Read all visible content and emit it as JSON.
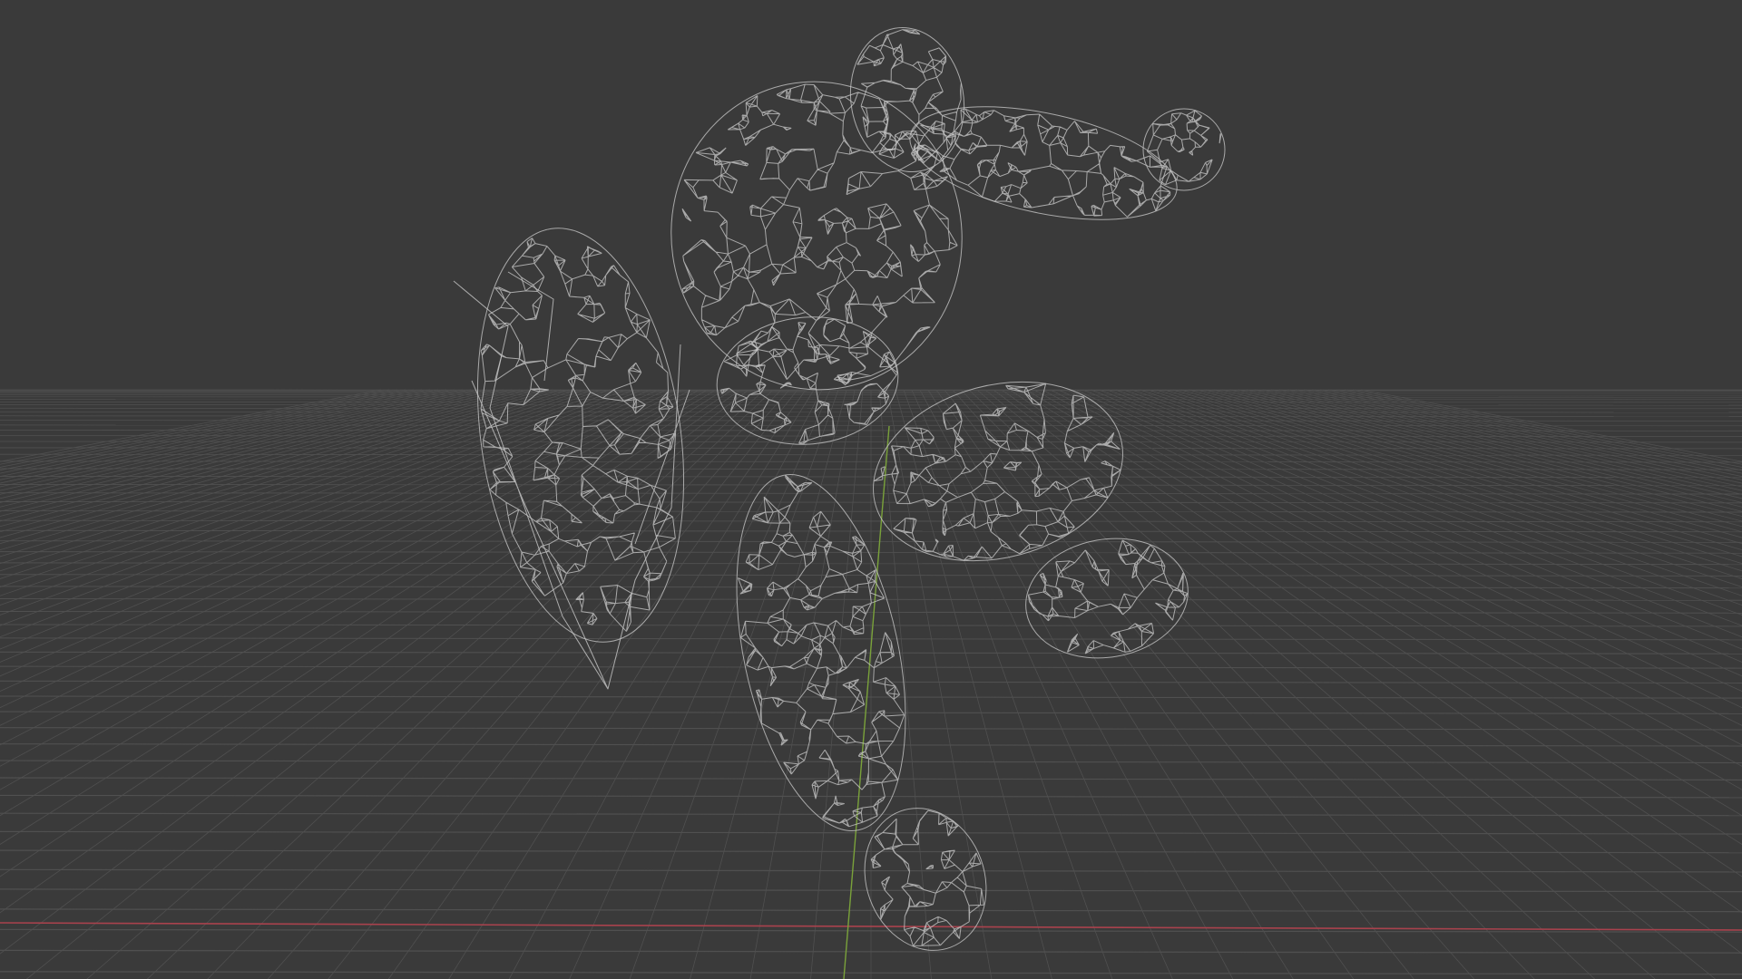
{
  "viewport": {
    "mode": "wireframe",
    "shading": "wireframe",
    "background_color": "#3a3a3a",
    "grid_color": "#505050",
    "x_axis_color": "#a9424d",
    "y_axis_color": "#7aa23a",
    "wire_color": "#c9c9c9",
    "show_grid": true,
    "show_axes": true
  },
  "object": {
    "type": "character-mesh",
    "pose": "mid-air leap",
    "parts": [
      "head",
      "torso",
      "pelvis",
      "left-arm-with-blade-gauntlet",
      "right-arm-outstretched",
      "right-hand",
      "left-leg-forward",
      "left-foot",
      "right-leg-bent",
      "right-foot"
    ]
  }
}
